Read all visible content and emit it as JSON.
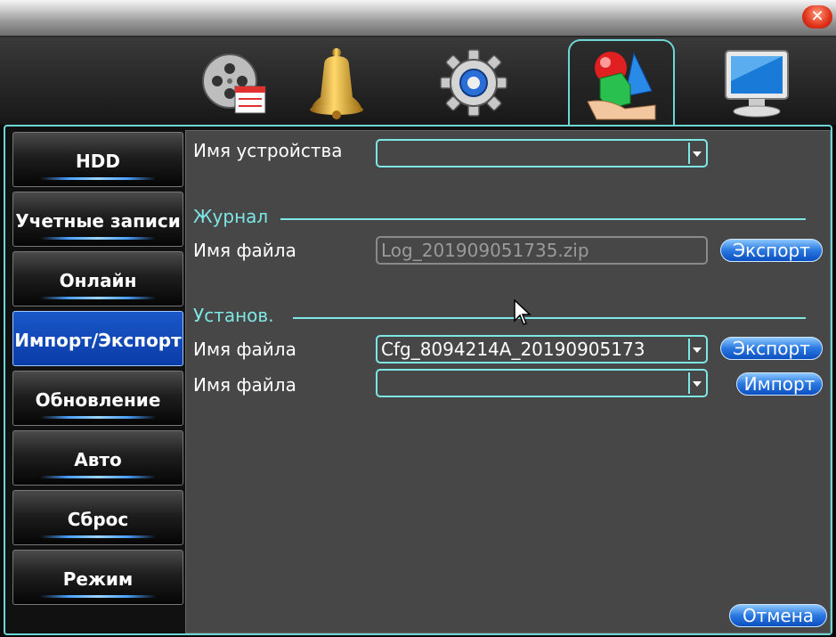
{
  "tabs": [
    {
      "name": "record-icon"
    },
    {
      "name": "alarm-bell-icon"
    },
    {
      "name": "system-settings-icon"
    },
    {
      "name": "advanced-tools-icon",
      "active": true
    },
    {
      "name": "monitor-icon"
    }
  ],
  "sidebar": {
    "items": [
      {
        "label": "HDD"
      },
      {
        "label": "Учетные записи"
      },
      {
        "label": "Онлайн"
      },
      {
        "label": "Импорт/Экспорт",
        "active": true
      },
      {
        "label": "Обновление"
      },
      {
        "label": "Авто"
      },
      {
        "label": "Сброс"
      },
      {
        "label": "Режим"
      }
    ]
  },
  "main": {
    "device_name_label": "Имя устройства",
    "device_name_value": "",
    "log": {
      "title": "Журнал",
      "file_label": "Имя файла",
      "file_value": "Log_201909051735.zip",
      "export_label": "Экспорт"
    },
    "config": {
      "title": "Установ.",
      "export_file_label": "Имя файла",
      "export_file_value": "Cfg_8094214A_20190905173",
      "export_label": "Экспорт",
      "import_file_label": "Имя файла",
      "import_file_value": "",
      "import_label": "Импорт"
    },
    "cancel_label": "Отмена"
  },
  "colors": {
    "accent": "#7fe6e6",
    "button": "#2a78e0",
    "panel": "#474747"
  }
}
